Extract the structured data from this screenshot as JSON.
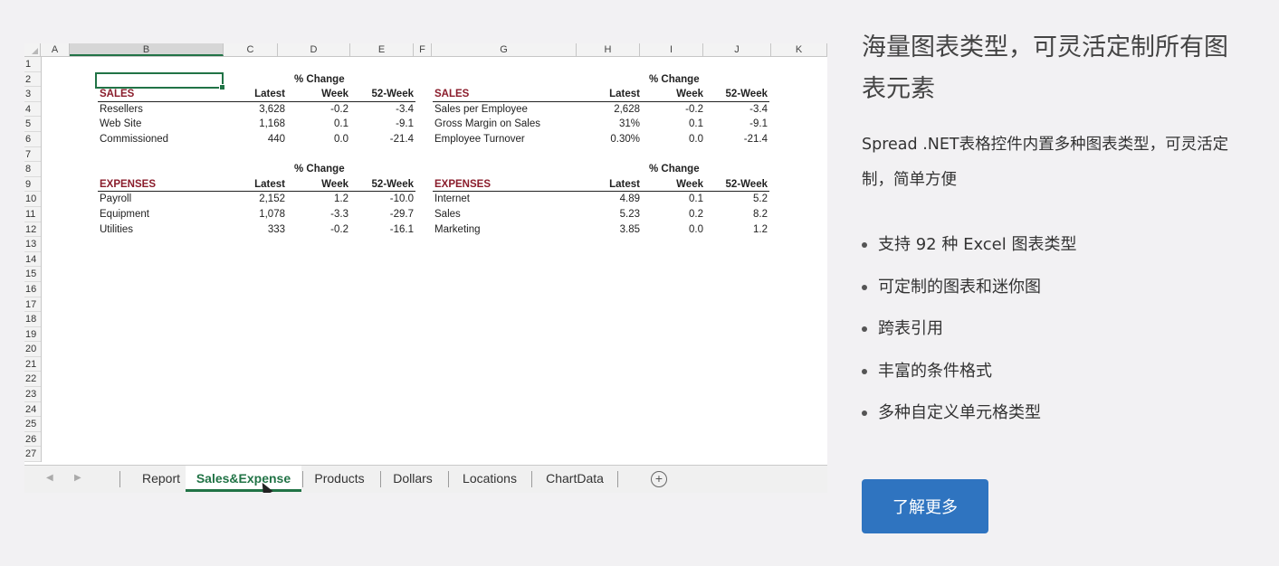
{
  "spreadsheet": {
    "column_headers": [
      "A",
      "B",
      "C",
      "D",
      "E",
      "F",
      "G",
      "H",
      "I",
      "J",
      "K"
    ],
    "row_numbers": [
      "1",
      "2",
      "3",
      "4",
      "5",
      "6",
      "7",
      "8",
      "9",
      "10",
      "11",
      "12",
      "13",
      "14",
      "15",
      "16",
      "17",
      "18",
      "19",
      "20",
      "21",
      "22",
      "23",
      "24",
      "25",
      "26",
      "27"
    ],
    "pct_change_label": "% Change",
    "col_latest": "Latest",
    "col_week": "Week",
    "col_52week": "52-Week",
    "left_sales": {
      "header": "SALES",
      "rows": [
        {
          "name": "Resellers",
          "latest": "3,628",
          "week": "-0.2",
          "w52": "-3.4"
        },
        {
          "name": "Web Site",
          "latest": "1,168",
          "week": "0.1",
          "w52": "-9.1"
        },
        {
          "name": "Commissioned",
          "latest": "440",
          "week": "0.0",
          "w52": "-21.4"
        }
      ]
    },
    "right_sales": {
      "header": "SALES",
      "rows": [
        {
          "name": "Sales per Employee",
          "latest": "2,628",
          "week": "-0.2",
          "w52": "-3.4"
        },
        {
          "name": "Gross Margin on Sales",
          "latest": "31%",
          "week": "0.1",
          "w52": "-9.1"
        },
        {
          "name": "Employee Turnover",
          "latest": "0.30%",
          "week": "0.0",
          "w52": "-21.4"
        }
      ]
    },
    "left_expenses": {
      "header": "EXPENSES",
      "rows": [
        {
          "name": "Payroll",
          "latest": "2,152",
          "week": "1.2",
          "w52": "-10.0"
        },
        {
          "name": "Equipment",
          "latest": "1,078",
          "week": "-3.3",
          "w52": "-29.7"
        },
        {
          "name": "Utilities",
          "latest": "333",
          "week": "-0.2",
          "w52": "-16.1"
        }
      ]
    },
    "right_expenses": {
      "header": "EXPENSES",
      "rows": [
        {
          "name": "Internet",
          "latest": "4.89",
          "week": "0.1",
          "w52": "5.2"
        },
        {
          "name": "Sales",
          "latest": "5.23",
          "week": "0.2",
          "w52": "8.2"
        },
        {
          "name": "Marketing",
          "latest": "3.85",
          "week": "0.0",
          "w52": "1.2"
        }
      ]
    },
    "tabs": [
      "Report",
      "Sales&Expense",
      "Products",
      "Dollars",
      "Locations",
      "ChartData"
    ],
    "active_tab": "Sales&Expense",
    "add_sheet_icon": "plus-circle-icon",
    "accent_color": "#217346",
    "header_red": "#8a1c2b"
  },
  "panel": {
    "title": "海量图表类型，可灵活定制所有图表元素",
    "description": "Spread .NET表格控件内置多种图表类型，可灵活定制，简单方便",
    "features": [
      "支持 92 种 Excel 图表类型",
      "可定制的图表和迷你图",
      "跨表引用",
      "丰富的条件格式",
      "多种自定义单元格类型"
    ],
    "button_label": "了解更多",
    "button_color": "#2f74c0"
  }
}
